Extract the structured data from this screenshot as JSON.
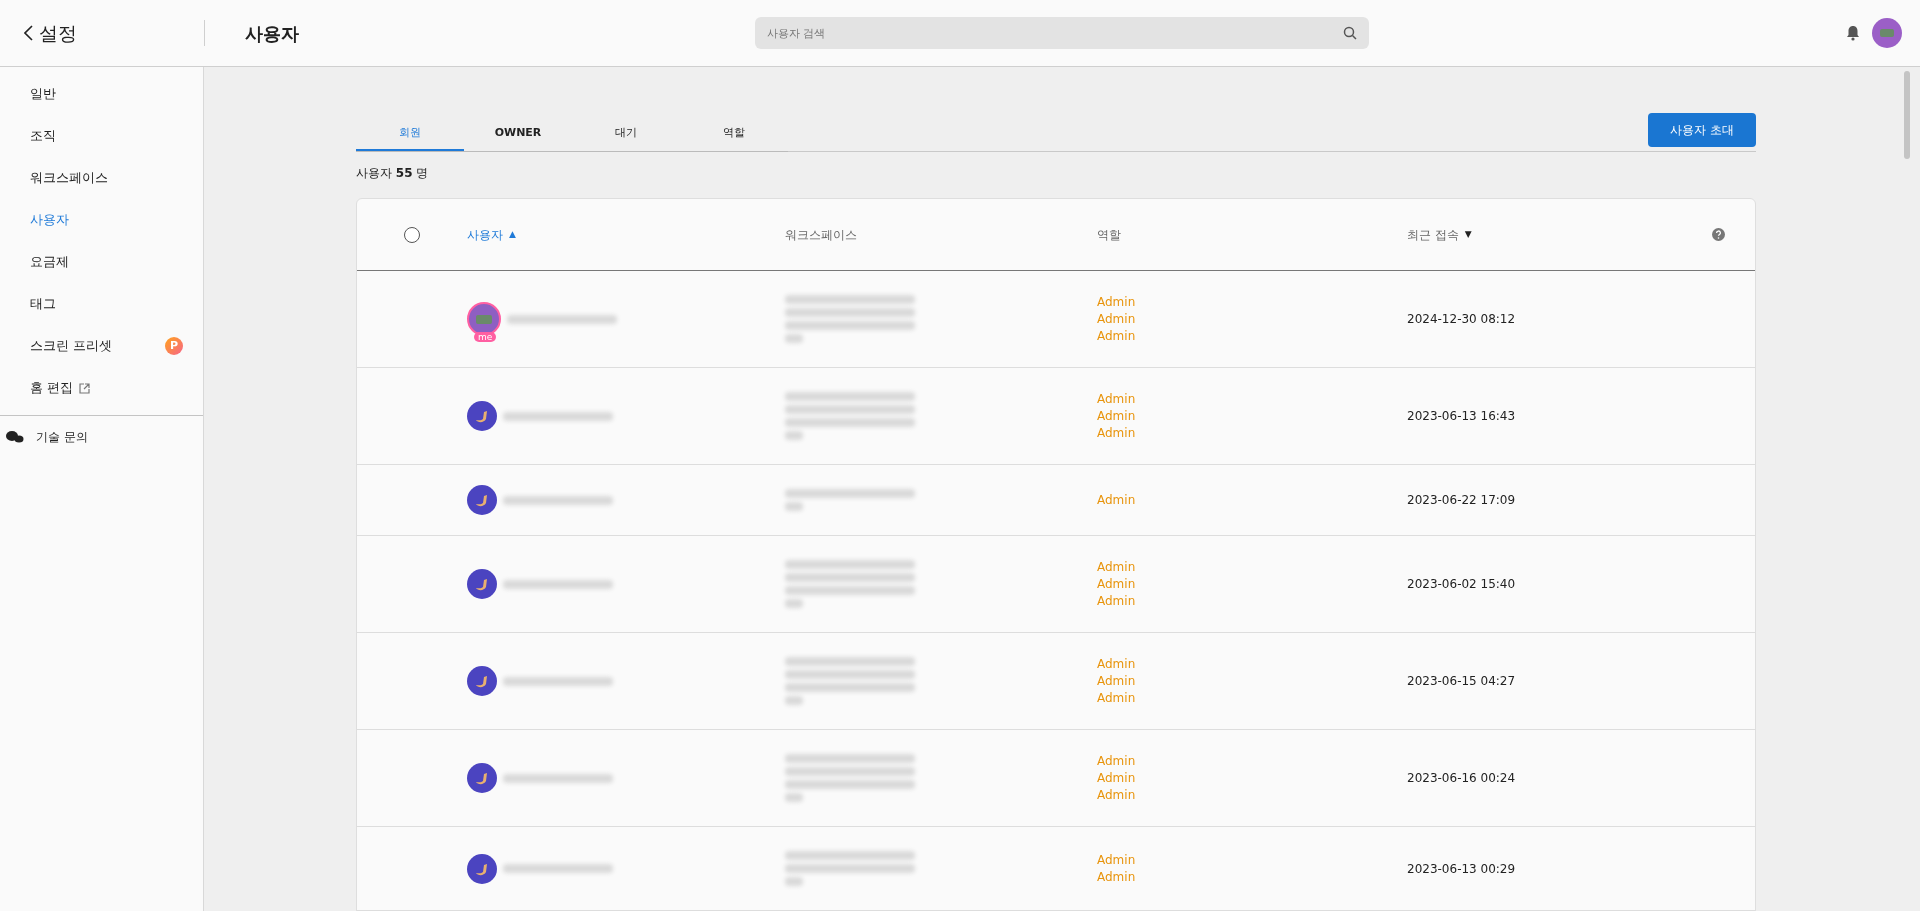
{
  "header": {
    "back_label": "설정",
    "title": "사용자",
    "search": {
      "placeholder": "사용자 검색"
    }
  },
  "sidebar": {
    "items": [
      {
        "label": "일반",
        "selected": false
      },
      {
        "label": "조직",
        "selected": false
      },
      {
        "label": "워크스페이스",
        "selected": false
      },
      {
        "label": "사용자",
        "selected": true
      },
      {
        "label": "요금제",
        "selected": false
      },
      {
        "label": "태그",
        "selected": false
      },
      {
        "label": "스크린 프리셋",
        "selected": false,
        "badge": "P"
      },
      {
        "label": "홈 편집",
        "selected": false,
        "external": true
      }
    ],
    "support": {
      "label": "기술 문의"
    }
  },
  "tabs": [
    {
      "label": "회원",
      "selected": true
    },
    {
      "label": "OWNER",
      "selected": false
    },
    {
      "label": "대기",
      "selected": false
    },
    {
      "label": "역할",
      "selected": false
    }
  ],
  "invite_button": "사용자 초대",
  "count": {
    "label": "사용자",
    "value": "55",
    "unit": "명"
  },
  "table": {
    "select_all": {
      "checked": false
    },
    "columns": [
      {
        "label": "사용자",
        "sort_arrow": "▲",
        "active": true
      },
      {
        "label": "워크스페이스",
        "active": false
      },
      {
        "label": "역할",
        "active": false
      },
      {
        "label": "최근 접속",
        "sort_arrow": "▼",
        "active": false
      }
    ],
    "rows": [
      {
        "kind": "me",
        "badge": "me",
        "roles": [
          "Admin",
          "Admin",
          "Admin"
        ],
        "last_access": "2024-12-30 08:12"
      },
      {
        "kind": "member",
        "roles": [
          "Admin",
          "Admin",
          "Admin"
        ],
        "last_access": "2023-06-13 16:43"
      },
      {
        "kind": "member",
        "roles": [
          "Admin"
        ],
        "last_access": "2023-06-22 17:09"
      },
      {
        "kind": "member",
        "roles": [
          "Admin",
          "Admin",
          "Admin"
        ],
        "last_access": "2023-06-02 15:40"
      },
      {
        "kind": "member",
        "roles": [
          "Admin",
          "Admin",
          "Admin"
        ],
        "last_access": "2023-06-15 04:27"
      },
      {
        "kind": "member",
        "roles": [
          "Admin",
          "Admin",
          "Admin"
        ],
        "last_access": "2023-06-16 00:24"
      },
      {
        "kind": "member",
        "roles": [
          "Admin",
          "Admin"
        ],
        "last_access": "2023-06-13 00:29"
      }
    ]
  }
}
